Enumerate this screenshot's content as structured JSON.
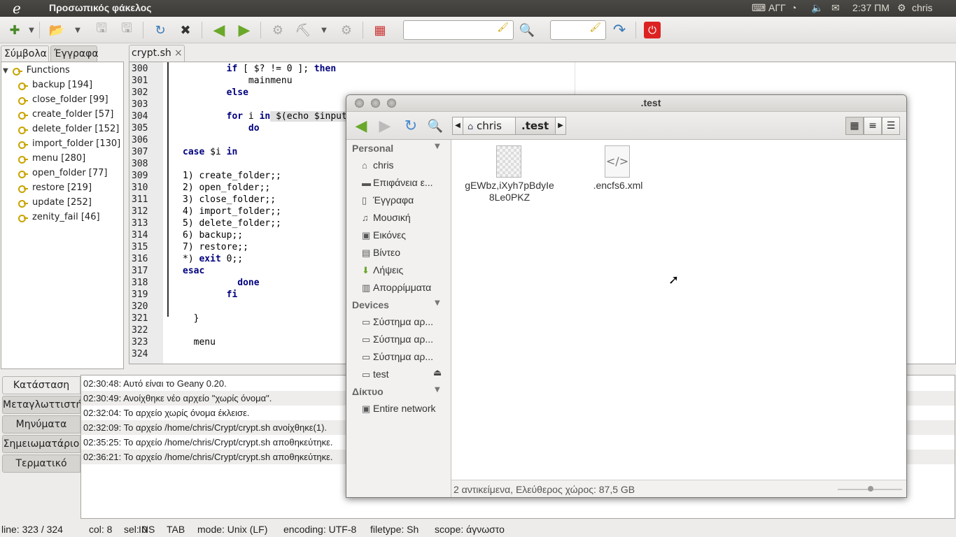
{
  "panel": {
    "logo": "ℯ",
    "app_title": "Προσωπικός φάκελος",
    "keyboard": "ΑΓΓ",
    "time": "2:37 ΠΜ",
    "user": "chris"
  },
  "sidebar": {
    "tabs": [
      "Σύμβολα",
      "Έγγραφα"
    ],
    "root": "Functions",
    "items": [
      "backup [194]",
      "close_folder [99]",
      "create_folder [57]",
      "delete_folder [152]",
      "import_folder [130]",
      "menu [280]",
      "open_folder [77]",
      "restore [219]",
      "update [252]",
      "zenity_fail [46]"
    ]
  },
  "editor": {
    "tab_label": "crypt.sh",
    "close_glyph": "×",
    "line_numbers": [
      "300",
      "301",
      "302",
      "303",
      "304",
      "305",
      "306",
      "307",
      "308",
      "309",
      "310",
      "311",
      "312",
      "313",
      "314",
      "315",
      "316",
      "317",
      "318",
      "319",
      "320",
      "321",
      "322",
      "323",
      "324"
    ],
    "lines": [
      {
        "n": "300",
        "indent": "        ",
        "kw": "if",
        "rest": " [ $? != 0 ]; ",
        "kw2": "then"
      },
      {
        "n": "301",
        "indent": "            ",
        "text": "mainmenu"
      },
      {
        "n": "302",
        "indent": "        ",
        "kw": "else"
      },
      {
        "n": "303",
        "text": ""
      },
      {
        "n": "304",
        "indent": "        ",
        "kw": "for",
        "rest": " i ",
        "kw2": "in",
        "rest2": " $(echo $input"
      },
      {
        "n": "305",
        "indent": "            ",
        "kw": "do"
      },
      {
        "n": "306",
        "text": ""
      },
      {
        "n": "307",
        "indent": "",
        "kw": "case",
        "rest": " $i ",
        "kw2": "in"
      },
      {
        "n": "308",
        "text": ""
      },
      {
        "n": "309",
        "text": "1) create_folder;;"
      },
      {
        "n": "310",
        "text": "2) open_folder;;"
      },
      {
        "n": "311",
        "text": "3) close_folder;;"
      },
      {
        "n": "312",
        "text": "4) import_folder;;"
      },
      {
        "n": "313",
        "text": "5) delete_folder;;"
      },
      {
        "n": "314",
        "text": "6) backup;;"
      },
      {
        "n": "315",
        "text": "7) restore;;"
      },
      {
        "n": "316",
        "text": "*) ",
        "kw": "exit",
        "rest": " 0;;"
      },
      {
        "n": "317",
        "indent": "",
        "kw": "esac"
      },
      {
        "n": "318",
        "indent": "          ",
        "kw": "done"
      },
      {
        "n": "319",
        "indent": "        ",
        "kw": "fi"
      },
      {
        "n": "320",
        "text": ""
      },
      {
        "n": "321",
        "text": "  }"
      },
      {
        "n": "322",
        "text": ""
      },
      {
        "n": "323",
        "text": "  menu"
      },
      {
        "n": "324",
        "text": ""
      }
    ]
  },
  "bottom": {
    "tabs": [
      "Κατάσταση",
      "Μεταγλωττιστής",
      "Μηνύματα",
      "Σημειωματάριο",
      "Τερματικό"
    ],
    "messages": [
      "02:30:48: Αυτό είναι το Geany 0.20.",
      "02:30:49: Ανοίχθηκε νέο αρχείο \"χωρίς όνομα\".",
      "02:32:04: Το αρχείο χωρίς όνομα έκλεισε.",
      "02:32:09: Το αρχείο /home/chris/Crypt/crypt.sh ανοίχθηκε(1).",
      "02:35:25: Το αρχείο /home/chris/Crypt/crypt.sh αποθηκεύτηκε.",
      "02:36:21: Το αρχείο /home/chris/Crypt/crypt.sh αποθηκεύτηκε."
    ]
  },
  "status": {
    "line": "line: 323 / 324",
    "col": "col: 8",
    "sel": "sel: 0",
    "ins": "INS",
    "tab": "TAB",
    "mode": "mode: Unix (LF)",
    "encoding": "encoding: UTF-8",
    "filetype": "filetype: Sh",
    "scope": "scope: άγνωστο"
  },
  "nautilus": {
    "title": ".test",
    "breadcrumbs": [
      "chris",
      ".test"
    ],
    "sections": [
      {
        "name": "Personal",
        "items": [
          {
            "icon": "⌂",
            "label": "chris"
          },
          {
            "icon": "▬",
            "label": "Επιφάνεια ε..."
          },
          {
            "icon": "▯",
            "label": "Έγγραφα"
          },
          {
            "icon": "♫",
            "label": "Μουσική"
          },
          {
            "icon": "▣",
            "label": "Εικόνες"
          },
          {
            "icon": "▤",
            "label": "Βίντεο"
          },
          {
            "icon": "⬇",
            "label": "Λήψεις"
          },
          {
            "icon": "▥",
            "label": "Απορρίμματα"
          }
        ]
      },
      {
        "name": "Devices",
        "items": [
          {
            "icon": "▭",
            "label": "Σύστημα αρ..."
          },
          {
            "icon": "▭",
            "label": "Σύστημα αρ..."
          },
          {
            "icon": "▭",
            "label": "Σύστημα αρ..."
          },
          {
            "icon": "▭",
            "label": "test"
          }
        ]
      },
      {
        "name": "Δίκτυο",
        "items": [
          {
            "icon": "▣",
            "label": "Entire network"
          }
        ]
      }
    ],
    "files": [
      {
        "name_line1": "gEWbz,iXyh7pBdyIe",
        "name_line2": "8Le0PKZ"
      },
      {
        "name_line1": ".encfs6.xml",
        "name_line2": ""
      }
    ],
    "status_text": "2 αντικείμενα, Ελεύθερος χώρος: 87,5 GB"
  }
}
